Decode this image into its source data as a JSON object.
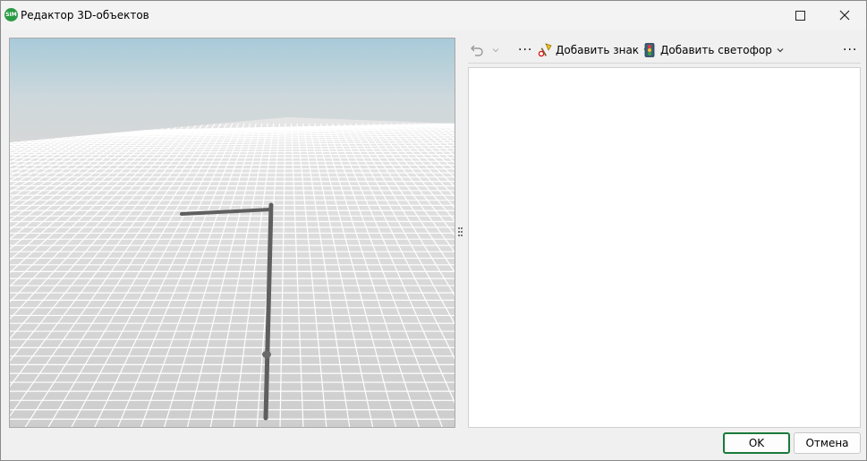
{
  "window": {
    "title": "Редактор 3D-объектов",
    "app_icon_text": "SIM",
    "maximize_icon": "maximize-icon",
    "close_icon": "close-icon"
  },
  "toolbar": {
    "undo_icon": "undo-icon",
    "more_label": "···",
    "add_sign_label": "Добавить знак",
    "add_light_label": "Добавить светофор",
    "overflow_label": "···"
  },
  "buttons": {
    "ok_label": "OK",
    "cancel_label": "Отмена"
  },
  "colors": {
    "ok_border": "#1a7a3a",
    "sky_top": "#a8cad9",
    "ground": "#d3d3d3",
    "pole": "#5f5f5f"
  }
}
